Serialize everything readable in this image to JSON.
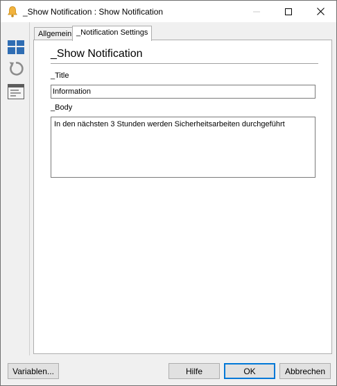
{
  "window": {
    "title": "_Show Notification : Show Notification",
    "icon": "bell-icon"
  },
  "tabs": [
    {
      "label": "Allgemein",
      "active": false
    },
    {
      "label": "_Notification Settings",
      "active": true
    }
  ],
  "toolbar": {
    "icons": [
      "layout-icon",
      "refresh-icon",
      "properties-icon"
    ]
  },
  "form": {
    "heading": "_Show Notification",
    "title_label": "_Title",
    "title_value": "Information",
    "body_label": "_Body",
    "body_value": "In den nächsten 3 Stunden werden Sicherheitsarbeiten durchgeführt"
  },
  "buttons": {
    "variables": "Variablen...",
    "help": "Hilfe",
    "ok": "OK",
    "cancel": "Abbrechen"
  },
  "colors": {
    "accent": "#0078d7",
    "icon_blue": "#2f6db3",
    "bell": "#f2b33d"
  }
}
